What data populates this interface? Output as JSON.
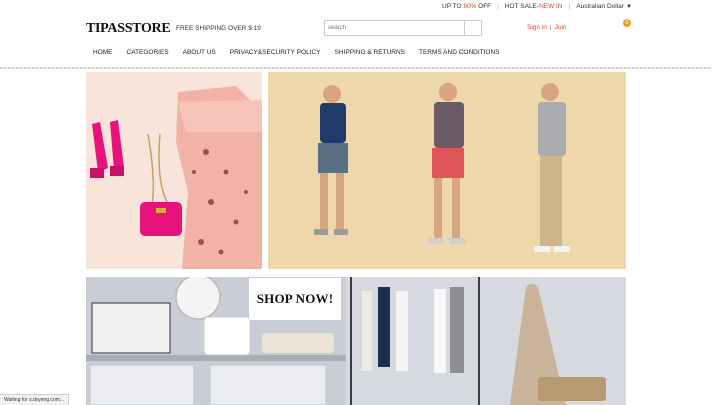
{
  "promo": {
    "offer_prefix": "UP TO",
    "offer_percent": "80%",
    "offer_suffix": "OFF",
    "hot_sale": "HOT SALE-",
    "new_in": "NEW IN",
    "currency": "Australian Dollar"
  },
  "header": {
    "logo": "TIPASSTORE",
    "shipping": "FREE SHIPPING OVER $ 19",
    "search_placeholder": "search",
    "sign_in": "Sign in",
    "join": "Join",
    "cart_count": "0"
  },
  "nav": {
    "items": [
      "HOME",
      "CATEGORIES",
      "ABOUT US",
      "PRIVACY&SECURITY POLICY",
      "SHIPPING & RETURNS",
      "TERMS AND CONDITIONS"
    ]
  },
  "banners": {
    "shop_now": "SHOP NOW!"
  },
  "status": "Waiting for s.dvyeng.com...",
  "colors": {
    "accent_red": "#e0452b",
    "cart_badge": "#f0a029"
  }
}
